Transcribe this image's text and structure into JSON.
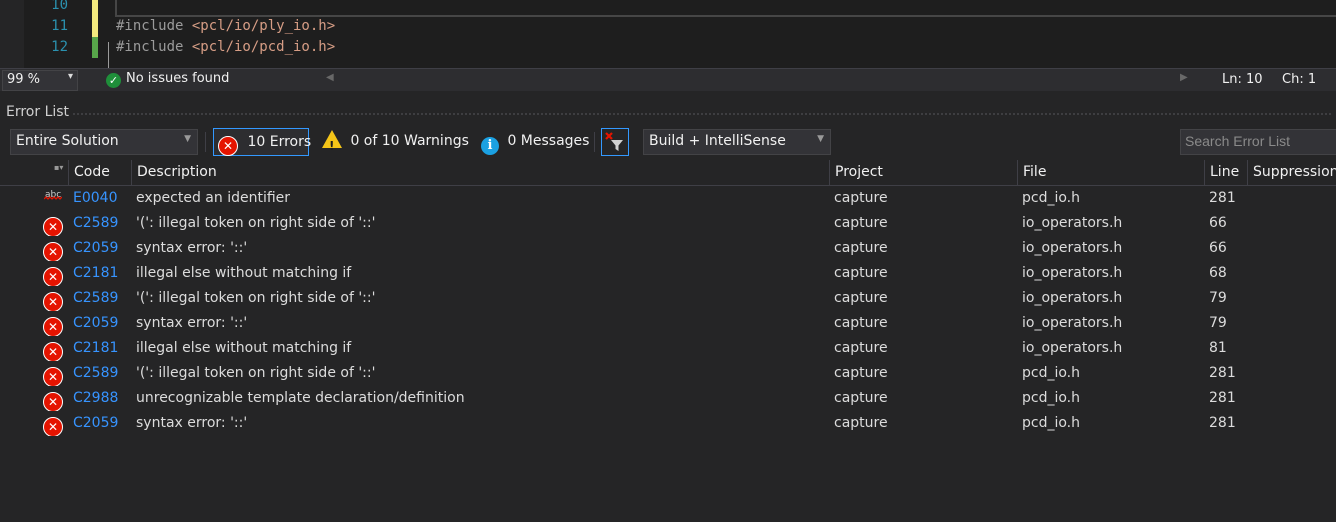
{
  "editor": {
    "lines": [
      {
        "number": "10",
        "code": "",
        "change_color": "#f2e97e"
      },
      {
        "number": "11",
        "prefix": "#include ",
        "string": "<pcl/io/ply_io.h>",
        "change_color": "#f2e97e"
      },
      {
        "number": "12",
        "prefix": "#include ",
        "string": "<pcl/io/pcd_io.h>",
        "change_color": "#57a64a"
      }
    ]
  },
  "status": {
    "zoom": "99 %",
    "issues_text": "No issues found",
    "issues_icon": "check-circle-icon",
    "line": "Ln: 10",
    "char": "Ch: 1"
  },
  "error_list": {
    "title": "Error List",
    "scope": "Entire Solution",
    "errors_label": "10 Errors",
    "warnings_label": "0 of 10 Warnings",
    "messages_label": "0 Messages",
    "build_filter": "Build + IntelliSense",
    "search_placeholder": "Search Error List",
    "columns": {
      "code": "Code",
      "description": "Description",
      "project": "Project",
      "file": "File",
      "line": "Line",
      "suppression": "Suppression"
    },
    "rows": [
      {
        "icon": "spelling-squiggle-icon",
        "code": "E0040",
        "description": "expected an identifier",
        "project": "capture",
        "file": "pcd_io.h",
        "line": "281"
      },
      {
        "icon": "error-icon",
        "code": "C2589",
        "description": "'(': illegal token on right side of '::'",
        "project": "capture",
        "file": "io_operators.h",
        "line": "66"
      },
      {
        "icon": "error-icon",
        "code": "C2059",
        "description": "syntax error: '::'",
        "project": "capture",
        "file": "io_operators.h",
        "line": "66"
      },
      {
        "icon": "error-icon",
        "code": "C2181",
        "description": "illegal else without matching if",
        "project": "capture",
        "file": "io_operators.h",
        "line": "68"
      },
      {
        "icon": "error-icon",
        "code": "C2589",
        "description": "'(': illegal token on right side of '::'",
        "project": "capture",
        "file": "io_operators.h",
        "line": "79"
      },
      {
        "icon": "error-icon",
        "code": "C2059",
        "description": "syntax error: '::'",
        "project": "capture",
        "file": "io_operators.h",
        "line": "79"
      },
      {
        "icon": "error-icon",
        "code": "C2181",
        "description": "illegal else without matching if",
        "project": "capture",
        "file": "io_operators.h",
        "line": "81"
      },
      {
        "icon": "error-icon",
        "code": "C2589",
        "description": "'(': illegal token on right side of '::'",
        "project": "capture",
        "file": "pcd_io.h",
        "line": "281"
      },
      {
        "icon": "error-icon",
        "code": "C2988",
        "description": "unrecognizable template declaration/definition",
        "project": "capture",
        "file": "pcd_io.h",
        "line": "281"
      },
      {
        "icon": "error-icon",
        "code": "C2059",
        "description": "syntax error: '::'",
        "project": "capture",
        "file": "pcd_io.h",
        "line": "281"
      }
    ]
  },
  "colors": {
    "background": "#1e1e1e",
    "panel": "#252526",
    "error_red": "#e51400",
    "code_link_blue": "#3794ff",
    "selection_blue": "#3399ff",
    "line_number": "#2b91af"
  }
}
